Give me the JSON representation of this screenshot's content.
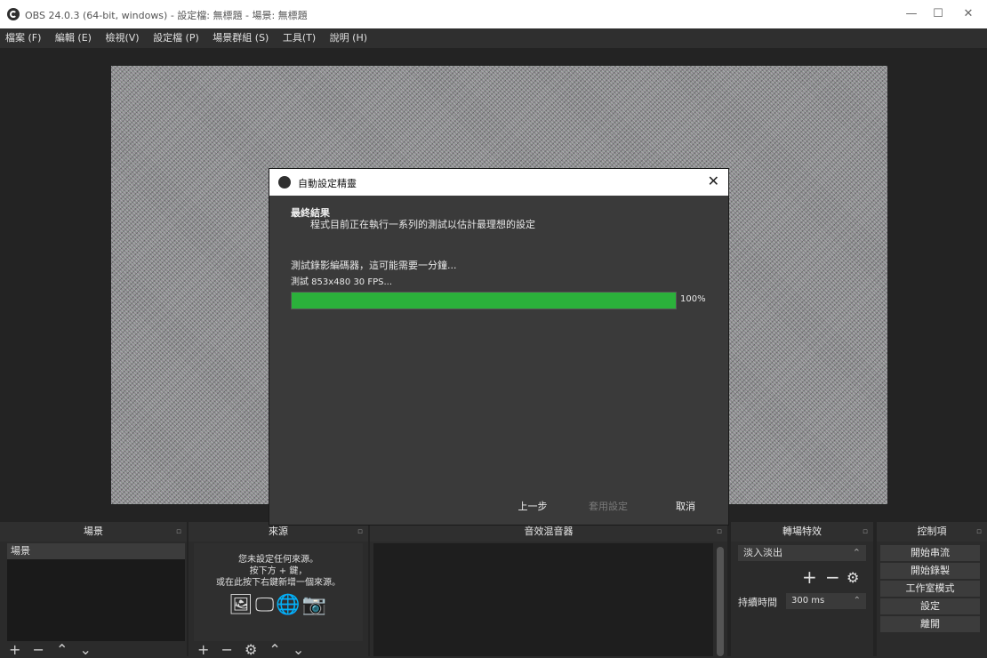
{
  "window": {
    "title": "OBS 24.0.3 (64-bit, windows) - 設定檔: 無標題 - 場景: 無標題",
    "minimize": "—",
    "maximize": "☐",
    "close": "✕"
  },
  "menu": [
    "檔案 (F)",
    "編輯 (E)",
    "檢視(V)",
    "設定檔 (P)",
    "場景群組 (S)",
    "工具(T)",
    "說明 (H)"
  ],
  "dialog": {
    "title": "自動設定精靈",
    "close": "✕",
    "heading": "最終結果",
    "subtitle": "程式目前正在執行一系列的測試以估計最理想的設定",
    "status_line1": "測試錄影編碼器，這可能需要一分鐘...",
    "status_line2": "測試 853x480 30 FPS...",
    "progress_percent": 100,
    "progress_label": "100%",
    "buttons": {
      "back": "上一步",
      "apply": "套用設定",
      "cancel": "取消"
    }
  },
  "docks": {
    "scenes": {
      "title": "場景",
      "items": [
        "場景"
      ],
      "tools": "+ − ⌃ ⌄"
    },
    "sources": {
      "title": "來源",
      "empty_line1": "您未設定任何來源。",
      "empty_line2": "按下方 + 鍵，",
      "empty_line3": "或在此按下右鍵新增一個來源。",
      "icons": "🖼🖵🌐📷",
      "tools": "+ − ⚙ ⌃ ⌄"
    },
    "mixer": {
      "title": "音效混音器"
    },
    "transitions": {
      "title": "轉場特效",
      "selected": "淡入淡出",
      "add": "+",
      "remove": "−",
      "gear": "⚙",
      "duration_label": "持續時間",
      "duration_value": "300 ms"
    },
    "controls": {
      "title": "控制項",
      "buttons": [
        "開始串流",
        "開始錄製",
        "工作室模式",
        "設定",
        "離開"
      ]
    },
    "float_glyph": "▫"
  },
  "colors": {
    "progress": "#2bb13b",
    "background": "#2b2b2b"
  }
}
